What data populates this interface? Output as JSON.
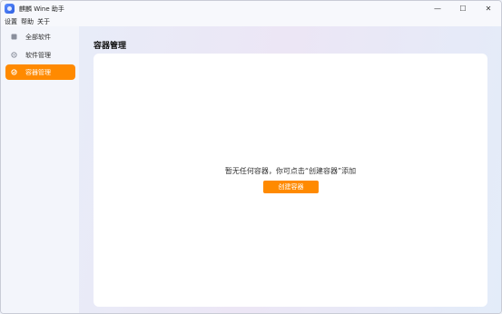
{
  "window": {
    "title": "麒麟 Wine 助手",
    "controls": {
      "minimize": "—",
      "maximize": "☐",
      "close": "✕"
    }
  },
  "menu": {
    "items": [
      {
        "label": "设置"
      },
      {
        "label": "帮助"
      },
      {
        "label": "关于"
      }
    ]
  },
  "sidebar": {
    "items": [
      {
        "label": "全部软件",
        "icon": "grid-icon",
        "active": false
      },
      {
        "label": "软件管理",
        "icon": "gear-icon",
        "active": false
      },
      {
        "label": "容器管理",
        "icon": "container-icon",
        "active": true
      }
    ]
  },
  "main": {
    "title": "容器管理",
    "empty_message": "暂无任何容器，你可点击“创建容器”添加",
    "create_button": "创建容器"
  },
  "colors": {
    "accent": "#ff8a00",
    "panel": "#ffffff"
  }
}
